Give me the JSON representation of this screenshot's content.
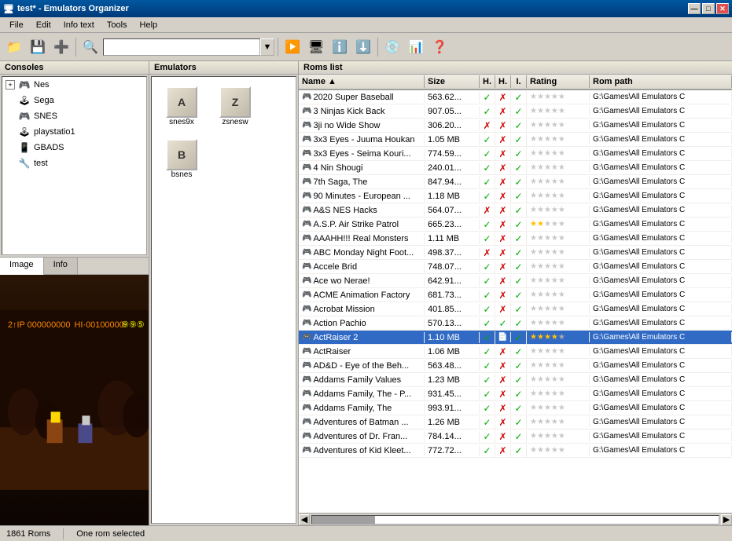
{
  "window": {
    "title": "test* - Emulators Organizer",
    "controls": [
      "—",
      "□",
      "✕"
    ]
  },
  "menubar": {
    "items": [
      "File",
      "Edit",
      "Info text",
      "Tools",
      "Help"
    ]
  },
  "toolbar": {
    "search_placeholder": ""
  },
  "consoles": {
    "header": "Consoles",
    "items": [
      {
        "name": "Nes",
        "icon": "🎮",
        "expandable": true
      },
      {
        "name": "Sega",
        "icon": "🕹"
      },
      {
        "name": "SNES",
        "icon": "🎮"
      },
      {
        "name": "playstatio1",
        "icon": "🕹"
      },
      {
        "name": "GBADS",
        "icon": "📱"
      },
      {
        "name": "test",
        "icon": "🔧"
      }
    ]
  },
  "emulators": {
    "header": "Emulators",
    "items": [
      {
        "name": "snes9x",
        "icon": "A"
      },
      {
        "name": "zsnesw",
        "icon": "Z"
      },
      {
        "name": "bsnes",
        "icon": "B"
      }
    ]
  },
  "roms": {
    "header": "Roms list",
    "columns": [
      "Name",
      "Size",
      "H.",
      "H.",
      "I.",
      "Rating",
      "Rom path"
    ],
    "rows": [
      {
        "name": "2020 Super Baseball",
        "size": "563.62...",
        "h1": true,
        "h2": false,
        "i": true,
        "rating": 0,
        "path": "G:\\Games\\All Emulators C"
      },
      {
        "name": "3 Ninjas Kick Back",
        "size": "907.05...",
        "h1": true,
        "h2": false,
        "i": true,
        "rating": 0,
        "path": "G:\\Games\\All Emulators C"
      },
      {
        "name": "3ji no Wide Show",
        "size": "306.20...",
        "h1": false,
        "h2": false,
        "i": true,
        "rating": 0,
        "path": "G:\\Games\\All Emulators C"
      },
      {
        "name": "3x3 Eyes - Juuma Houkan",
        "size": "1.05 MB",
        "h1": true,
        "h2": false,
        "i": true,
        "rating": 0,
        "path": "G:\\Games\\All Emulators C"
      },
      {
        "name": "3x3 Eyes - Seima Kouri...",
        "size": "774.59...",
        "h1": true,
        "h2": false,
        "i": true,
        "rating": 0,
        "path": "G:\\Games\\All Emulators C"
      },
      {
        "name": "4 Nin Shougi",
        "size": "240.01...",
        "h1": true,
        "h2": false,
        "i": true,
        "rating": 0,
        "path": "G:\\Games\\All Emulators C"
      },
      {
        "name": "7th Saga, The",
        "size": "847.94...",
        "h1": true,
        "h2": false,
        "i": true,
        "rating": 0,
        "path": "G:\\Games\\All Emulators C"
      },
      {
        "name": "90 Minutes - European ...",
        "size": "1.18 MB",
        "h1": true,
        "h2": false,
        "i": true,
        "rating": 0,
        "path": "G:\\Games\\All Emulators C"
      },
      {
        "name": "A&S NES Hacks",
        "size": "564.07...",
        "h1": false,
        "h2": false,
        "i": true,
        "rating": 0,
        "path": "G:\\Games\\All Emulators C"
      },
      {
        "name": "A.S.P. Air Strike Patrol",
        "size": "665.23...",
        "h1": true,
        "h2": false,
        "i": true,
        "rating": 2,
        "path": "G:\\Games\\All Emulators C"
      },
      {
        "name": "AAAHH!!! Real Monsters",
        "size": "1.11 MB",
        "h1": true,
        "h2": false,
        "i": true,
        "rating": 0,
        "path": "G:\\Games\\All Emulators C"
      },
      {
        "name": "ABC Monday Night Foot...",
        "size": "498.37...",
        "h1": false,
        "h2": false,
        "i": true,
        "rating": 0,
        "path": "G:\\Games\\All Emulators C"
      },
      {
        "name": "Accele Brid",
        "size": "748.07...",
        "h1": true,
        "h2": false,
        "i": true,
        "rating": 0,
        "path": "G:\\Games\\All Emulators C"
      },
      {
        "name": "Ace wo Nerae!",
        "size": "642.91...",
        "h1": true,
        "h2": false,
        "i": true,
        "rating": 0,
        "path": "G:\\Games\\All Emulators C"
      },
      {
        "name": "ACME Animation Factory",
        "size": "681.73...",
        "h1": true,
        "h2": false,
        "i": true,
        "rating": 0,
        "path": "G:\\Games\\All Emulators C"
      },
      {
        "name": "Acrobat Mission",
        "size": "401.85...",
        "h1": true,
        "h2": false,
        "i": true,
        "rating": 0,
        "path": "G:\\Games\\All Emulators C"
      },
      {
        "name": "Action Pachio",
        "size": "570.13...",
        "h1": true,
        "h2": true,
        "i": true,
        "rating": 0,
        "path": "G:\\Games\\All Emulators C"
      },
      {
        "name": "ActRaiser 2",
        "size": "1.10 MB",
        "h1": true,
        "h2": false,
        "i": true,
        "rating": 4,
        "path": "G:\\Games\\All Emulators C",
        "selected": true
      },
      {
        "name": "ActRaiser",
        "size": "1.06 MB",
        "h1": true,
        "h2": false,
        "i": true,
        "rating": 0,
        "path": "G:\\Games\\All Emulators C"
      },
      {
        "name": "AD&D - Eye of the Beh...",
        "size": "563.48...",
        "h1": true,
        "h2": false,
        "i": true,
        "rating": 0,
        "path": "G:\\Games\\All Emulators C"
      },
      {
        "name": "Addams Family Values",
        "size": "1.23 MB",
        "h1": true,
        "h2": false,
        "i": true,
        "rating": 0,
        "path": "G:\\Games\\All Emulators C"
      },
      {
        "name": "Addams Family, The - P...",
        "size": "931.45...",
        "h1": true,
        "h2": false,
        "i": true,
        "rating": 0,
        "path": "G:\\Games\\All Emulators C"
      },
      {
        "name": "Addams Family, The",
        "size": "993.91...",
        "h1": true,
        "h2": false,
        "i": true,
        "rating": 0,
        "path": "G:\\Games\\All Emulators C"
      },
      {
        "name": "Adventures of Batman ...",
        "size": "1.26 MB",
        "h1": true,
        "h2": false,
        "i": true,
        "rating": 0,
        "path": "G:\\Games\\All Emulators C"
      },
      {
        "name": "Adventures of Dr. Fran...",
        "size": "784.14...",
        "h1": true,
        "h2": false,
        "i": true,
        "rating": 0,
        "path": "G:\\Games\\All Emulators C"
      },
      {
        "name": "Adventures of Kid Kleet...",
        "size": "772.72...",
        "h1": true,
        "h2": false,
        "i": true,
        "rating": 0,
        "path": "G:\\Games\\All Emulators C"
      }
    ]
  },
  "statusbar": {
    "roms_count": "1861 Roms",
    "selection": "One rom selected"
  },
  "tabs": {
    "image": "Image",
    "info": "Info"
  }
}
